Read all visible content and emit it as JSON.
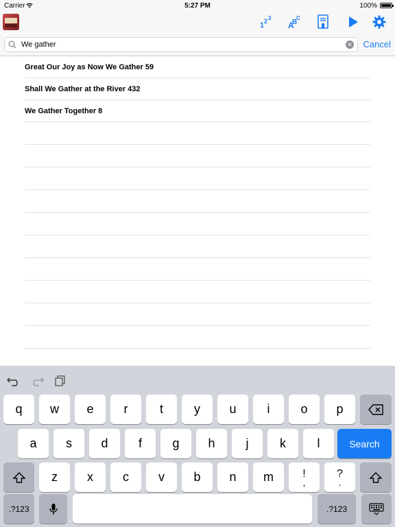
{
  "status_bar": {
    "carrier": "Carrier",
    "time": "5:27 PM",
    "battery": "100%"
  },
  "toolbar": {
    "buttons": [
      {
        "name": "number-sort",
        "icon": "number-123-icon"
      },
      {
        "name": "alpha-sort",
        "icon": "alphabet-abc-icon"
      },
      {
        "name": "bookmark",
        "icon": "bookmark-icon"
      },
      {
        "name": "play",
        "icon": "play-icon"
      },
      {
        "name": "settings",
        "icon": "gear-icon"
      }
    ],
    "accent": "#1a7cf5"
  },
  "search": {
    "value": "We gather",
    "cancel_label": "Cancel"
  },
  "results": [
    "Great Our Joy as Now We Gather 59",
    "Shall We Gather at the River 432",
    "We Gather Together 8"
  ],
  "keyboard": {
    "row1": [
      "q",
      "w",
      "e",
      "r",
      "t",
      "y",
      "u",
      "i",
      "o",
      "p"
    ],
    "row2": [
      "a",
      "s",
      "d",
      "f",
      "g",
      "h",
      "j",
      "k",
      "l"
    ],
    "row3": [
      "z",
      "x",
      "c",
      "v",
      "b",
      "n",
      "m"
    ],
    "punct1_top": "!",
    "punct1_bottom": ",",
    "punct2_top": "?",
    "punct2_bottom": ".",
    "search_label": "Search",
    "numbers_label": ".?123"
  }
}
